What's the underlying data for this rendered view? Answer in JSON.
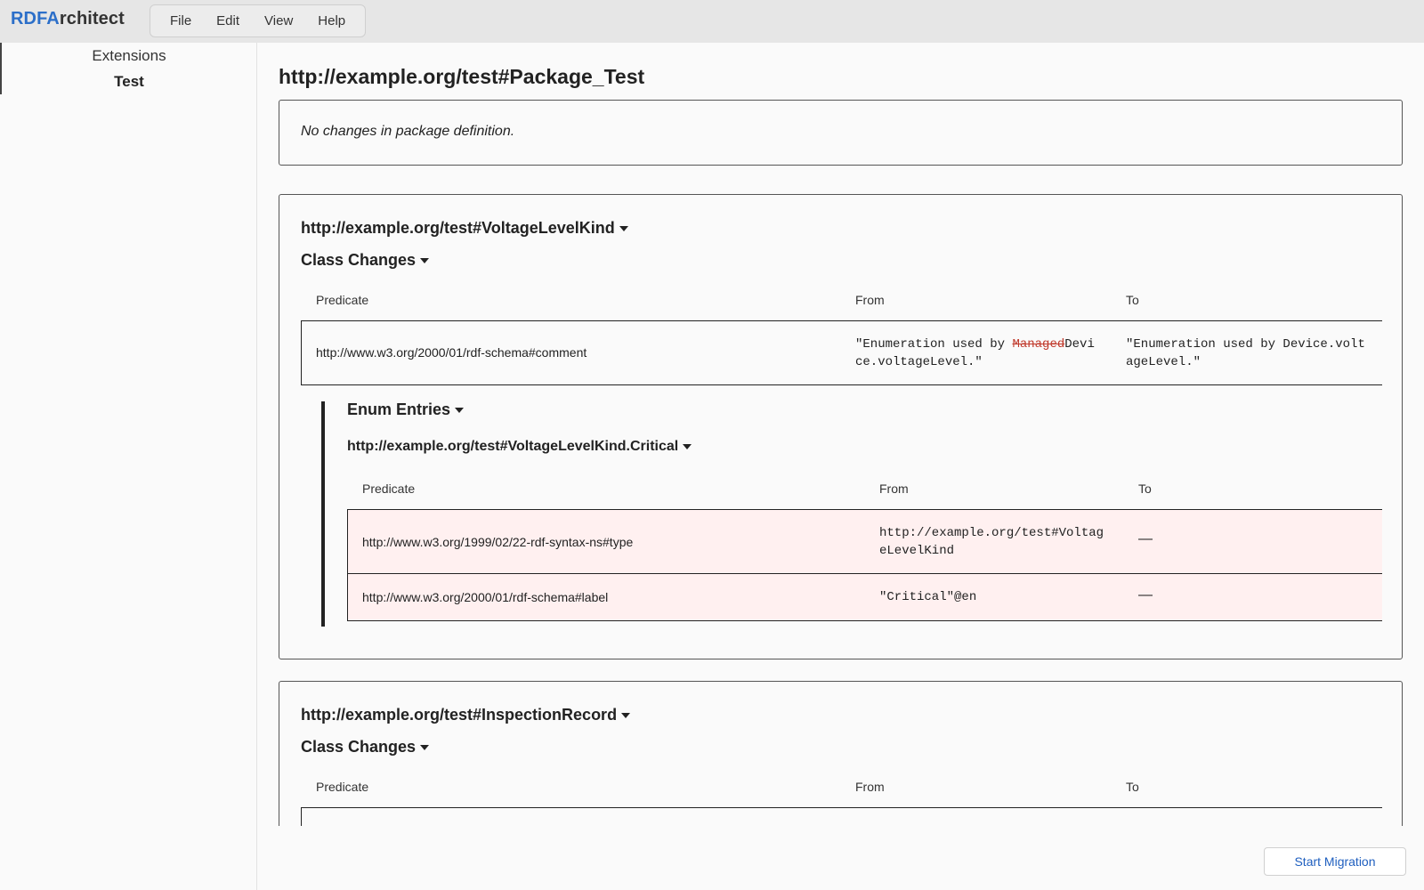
{
  "app": {
    "brand_prefix": "RDFA",
    "brand_suffix": "rchitect"
  },
  "menu": [
    "File",
    "Edit",
    "View",
    "Help"
  ],
  "sidebar": {
    "title": "Extensions",
    "items": [
      {
        "label": "Test",
        "active": true
      }
    ]
  },
  "main": {
    "package_title": "http://example.org/test#Package_Test",
    "package_message": "No changes in package definition.",
    "sections": [
      {
        "entity": "http://example.org/test#VoltageLevelKind",
        "class_changes_label": "Class Changes",
        "columns": [
          "Predicate",
          "From",
          "To"
        ],
        "rows": [
          {
            "predicate": "http://www.w3.org/2000/01/rdf-schema#comment",
            "from_line1_a": "\"Enumeration used by ",
            "from_line1_deleted": "Managed",
            "from_line1_b": "Devi",
            "from_line2": "ce.voltageLevel.\"",
            "to_line1": "\"Enumeration used by Device.volt",
            "to_line2": "ageLevel.\""
          }
        ],
        "enum_entries": {
          "label": "Enum Entries",
          "entry": "http://example.org/test#VoltageLevelKind.Critical",
          "columns": [
            "Predicate",
            "From",
            "To"
          ],
          "rows": [
            {
              "predicate": "http://www.w3.org/1999/02/22-rdf-syntax-ns#type",
              "from_line1": "http://example.org/test#Voltag",
              "from_line2": "eLevelKind",
              "to": "—"
            },
            {
              "predicate": "http://www.w3.org/2000/01/rdf-schema#label",
              "from_line1": "\"Critical\"@en",
              "to": "—"
            }
          ]
        }
      },
      {
        "entity": "http://example.org/test#InspectionRecord",
        "class_changes_label": "Class Changes",
        "columns": [
          "Predicate",
          "From",
          "To"
        ]
      }
    ]
  },
  "footer": {
    "start_migration": "Start Migration"
  },
  "colors": {
    "brand_accent": "#2c6fc9",
    "deleted_text": "#c0392b",
    "removed_row_bg": "#fff0f0",
    "button_text": "#1f5fbf"
  }
}
